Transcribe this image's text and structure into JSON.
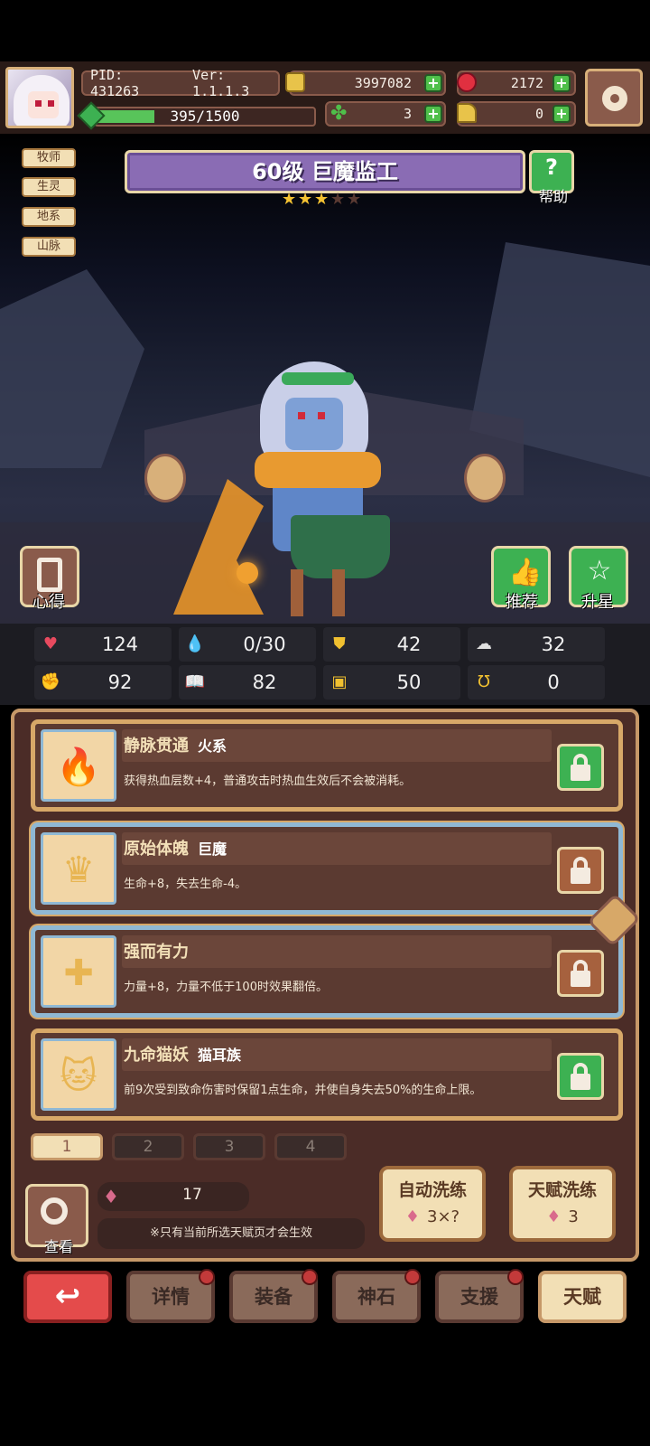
{
  "header": {
    "pid": "PID: 431263",
    "version": "Ver: 1.1.1.3",
    "gold": "3997082",
    "gems": "2172",
    "energy": "395/1500",
    "clover": "3",
    "trumpet": "0",
    "energy_progress": 0.263
  },
  "tags": [
    "牧师",
    "生灵",
    "地系",
    "山脉"
  ],
  "hero": {
    "title": "60级 巨魔监工",
    "stars_filled": 3,
    "stars_total": 5,
    "star_char": "★",
    "help_label": "帮助",
    "help_symbol": "?"
  },
  "side_buttons": {
    "insight": "心得",
    "recommend": "推荐",
    "upstar": "升星"
  },
  "stats": [
    {
      "icon": "heart-icon",
      "glyph": "♥",
      "color": "#e84a5f",
      "value": "124"
    },
    {
      "icon": "water-drop-icon",
      "glyph": "💧",
      "color": "#7fd0f0",
      "value": "0/30"
    },
    {
      "icon": "shield-icon",
      "glyph": "⛊",
      "color": "#f0c030",
      "value": "42"
    },
    {
      "icon": "wing-icon",
      "glyph": "☁",
      "color": "#e0e0e0",
      "value": "32"
    },
    {
      "icon": "fist-icon",
      "glyph": "✊",
      "color": "#f0b090",
      "value": "92"
    },
    {
      "icon": "book-icon",
      "glyph": "📖",
      "color": "#e05050",
      "value": "82"
    },
    {
      "icon": "boot-icon",
      "glyph": "▣",
      "color": "#f0c030",
      "value": "50"
    },
    {
      "icon": "magnet-icon",
      "glyph": "Ʊ",
      "color": "#f0c030",
      "value": "0"
    }
  ],
  "talents": [
    {
      "name": "静脉贯通",
      "sub": "火系",
      "desc": "获得热血层数+4，普通攻击时热血生效后不会被消耗。",
      "symbol": "🔥",
      "locked": true
    },
    {
      "name": "原始体魄",
      "sub": "巨魔",
      "desc": "生命+8，失去生命-4。",
      "symbol": "♛",
      "locked": false
    },
    {
      "name": "强而有力",
      "sub": "",
      "desc": "力量+8，力量不低于100时效果翻倍。",
      "symbol": "✚",
      "locked": false
    },
    {
      "name": "九命猫妖",
      "sub": "猫耳族",
      "desc": "前9次受到致命伤害时保留1点生命，并使自身失去50%的生命上限。",
      "symbol": "🐱",
      "locked": true
    }
  ],
  "pages": [
    "1",
    "2",
    "3",
    "4"
  ],
  "bottom": {
    "view_label": "查看",
    "gem_count": "17",
    "gem_glyph": "♦",
    "note": "※只有当前所选天赋页才会生效",
    "auto_reset": {
      "label": "自动洗练",
      "cost": "3×?"
    },
    "talent_reset": {
      "label": "天赋洗练",
      "cost": "3"
    }
  },
  "nav": {
    "back": "↩",
    "details": "详情",
    "equipment": "装备",
    "stone": "神石",
    "support": "支援",
    "talent": "天赋"
  }
}
